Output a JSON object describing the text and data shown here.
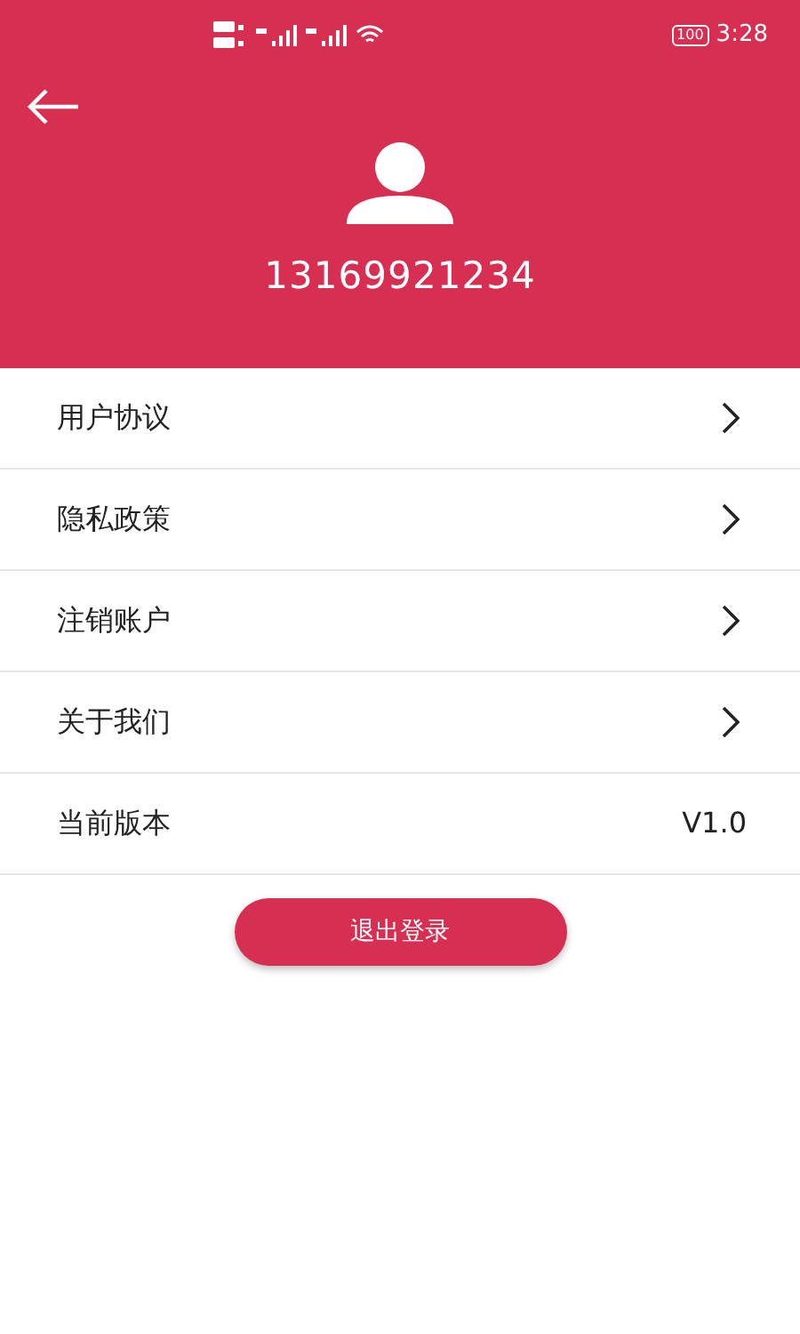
{
  "status_bar": {
    "battery": "100",
    "time": "3:28"
  },
  "header": {
    "phone": "13169921234"
  },
  "menu": [
    {
      "kind": "link",
      "label": "用户协议"
    },
    {
      "kind": "link",
      "label": "隐私政策"
    },
    {
      "kind": "link",
      "label": "注销账户"
    },
    {
      "kind": "link",
      "label": "关于我们"
    },
    {
      "kind": "value",
      "label": "当前版本",
      "value": "V1.0"
    }
  ],
  "logout_button": "退出登录"
}
